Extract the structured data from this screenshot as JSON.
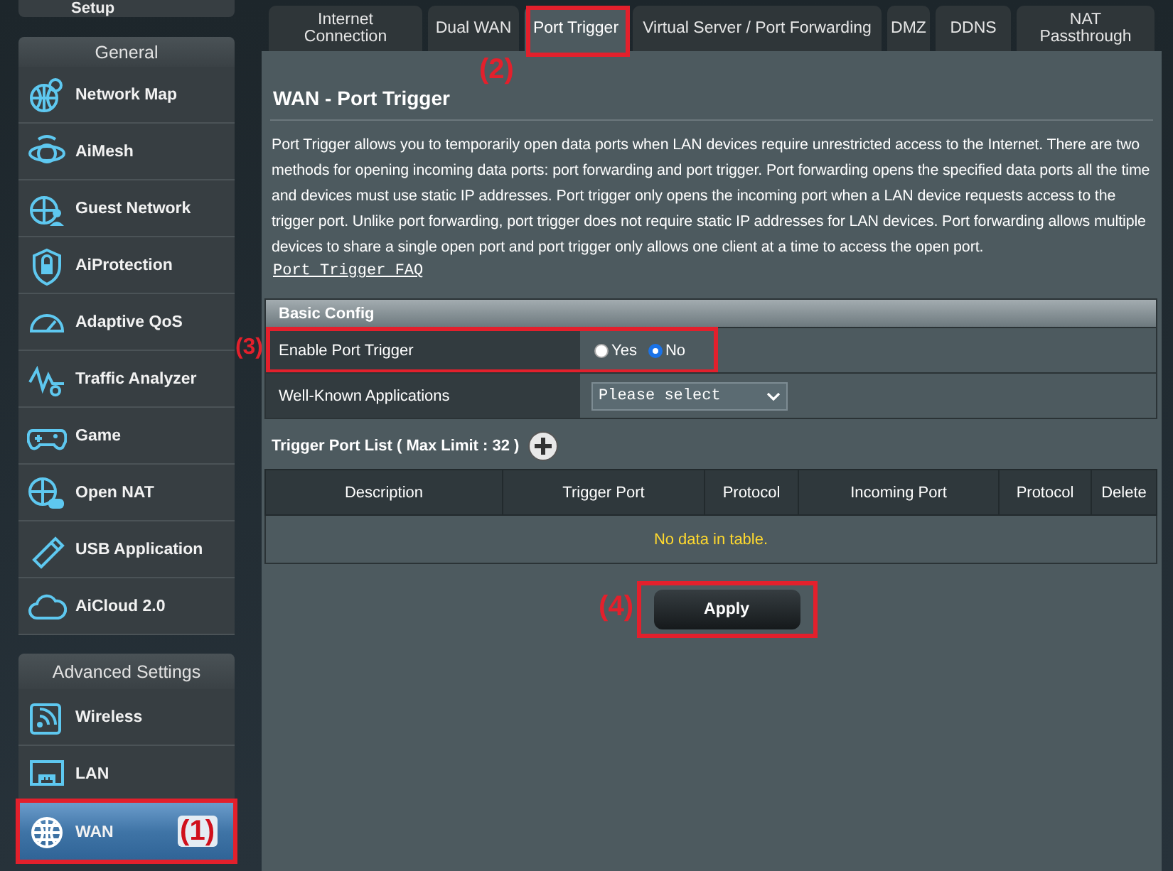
{
  "sidebar": {
    "top_item": {
      "label": "Setup"
    },
    "sections": [
      {
        "title": "General",
        "items": [
          {
            "label": "Network Map",
            "selected": false
          },
          {
            "label": "AiMesh",
            "selected": false
          },
          {
            "label": "Guest Network",
            "selected": false
          },
          {
            "label": "AiProtection",
            "selected": false
          },
          {
            "label": "Adaptive QoS",
            "selected": false
          },
          {
            "label": "Traffic Analyzer",
            "selected": false
          },
          {
            "label": "Game",
            "selected": false
          },
          {
            "label": "Open NAT",
            "selected": false
          },
          {
            "label": "USB Application",
            "selected": false
          },
          {
            "label": "AiCloud 2.0",
            "selected": false
          }
        ]
      },
      {
        "title": "Advanced Settings",
        "items": [
          {
            "label": "Wireless",
            "selected": false
          },
          {
            "label": "LAN",
            "selected": false
          },
          {
            "label": "WAN",
            "selected": true,
            "callout": "(1)"
          }
        ]
      }
    ]
  },
  "tabs": [
    {
      "label": "Internet Connection",
      "selected": false
    },
    {
      "label": "Dual WAN",
      "selected": false
    },
    {
      "label": "Port Trigger",
      "selected": true,
      "callout": "(2)"
    },
    {
      "label": "Virtual Server / Port Forwarding",
      "selected": false
    },
    {
      "label": "DMZ",
      "selected": false
    },
    {
      "label": "DDNS",
      "selected": false
    },
    {
      "label": "NAT Passthrough",
      "selected": false
    }
  ],
  "page": {
    "title": "WAN - Port Trigger",
    "description": "Port Trigger allows you to temporarily open data ports when LAN devices require unrestricted access to the Internet. There are two methods for opening incoming data ports: port forwarding and port trigger. Port forwarding opens the specified data ports all the time and devices must use static IP addresses. Port trigger only opens the incoming port when a LAN device requests access to the trigger port. Unlike port forwarding, port trigger does not require static IP addresses for LAN devices. Port forwarding allows multiple devices to share a single open port and port trigger only allows one client at a time to access the open port.",
    "faq_link": "Port Trigger FAQ",
    "basic_config": {
      "title": "Basic Config",
      "enable": {
        "label": "Enable Port Trigger",
        "callout": "(3)",
        "options": [
          {
            "label": "Yes",
            "selected": false
          },
          {
            "label": "No",
            "selected": true
          }
        ]
      },
      "applications": {
        "label": "Well-Known Applications",
        "value": "Please select"
      }
    },
    "trigger_list": {
      "title": "Trigger Port List ( Max Limit : 32 )",
      "columns": [
        "Description",
        "Trigger Port",
        "Protocol",
        "Incoming Port",
        "Protocol",
        "Delete"
      ],
      "empty_message": "No data in table."
    },
    "apply": {
      "label": "Apply",
      "callout": "(4)"
    }
  }
}
